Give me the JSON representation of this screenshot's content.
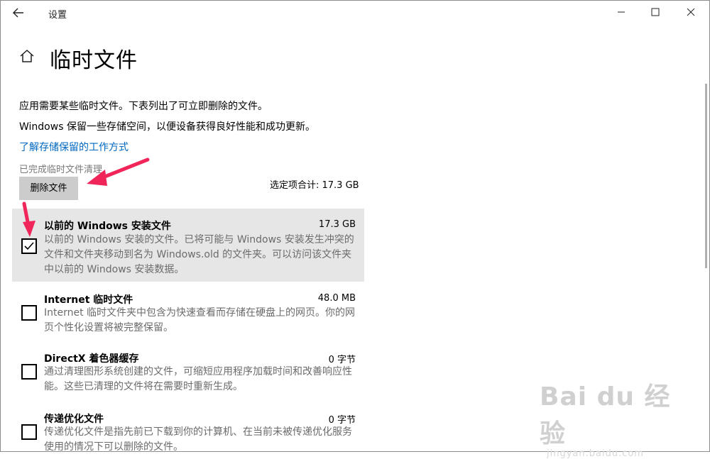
{
  "window": {
    "title": "设置",
    "back_icon": "back-arrow-icon",
    "minimize_icon": "minimize-icon",
    "maximize_icon": "maximize-icon",
    "close_icon": "close-icon"
  },
  "page": {
    "home_icon": "home-icon",
    "title": "临时文件",
    "description1": "应用需要某些临时文件。下表列出了可立即删除的文件。",
    "description2": "Windows 保留一些存储空间，以便设备获得良好性能和成功更新。",
    "link": "了解存储保留的工作方式",
    "status": "已完成临时文件清理",
    "delete_button": "删除文件",
    "selected_total": "选定项合计: 17.3 GB"
  },
  "items": [
    {
      "title": "以前的 Windows 安装文件",
      "size": "17.3 GB",
      "description": "以前的 Windows 安装的文件。已将可能与 Windows 安装发生冲突的文件和文件夹移动到名为 Windows.old 的文件夹。可以访问该文件夹中以前的 Windows 安装数据。",
      "checked": true
    },
    {
      "title": "Internet 临时文件",
      "size": "48.0 MB",
      "description": "Internet 临时文件夹中包含为快速查看而存储在硬盘上的网页。你的网页个性化设置将被完整保留。",
      "checked": false
    },
    {
      "title": "DirectX 着色器缓存",
      "size": "0 字节",
      "description": "通过清理图形系统创建的文件，可缩短应用程序加载时间和改善响应性能。这些已清理的文件将在需要时重新生成。",
      "checked": false
    },
    {
      "title": "传递优化文件",
      "size": "0 字节",
      "description": "传递优化文件是指先前已下载到你的计算机、在当前未被传递优化服务使用的情况下可以删除的文件。",
      "checked": false
    }
  ],
  "watermark": {
    "main": "Bai du 经验",
    "sub": "jingyan.baidu.com"
  },
  "colors": {
    "link": "#0067c0",
    "selected_row": "#e6e6e6",
    "delete_button_bg": "#cccccc",
    "annotation_arrow": "#f0265a"
  }
}
